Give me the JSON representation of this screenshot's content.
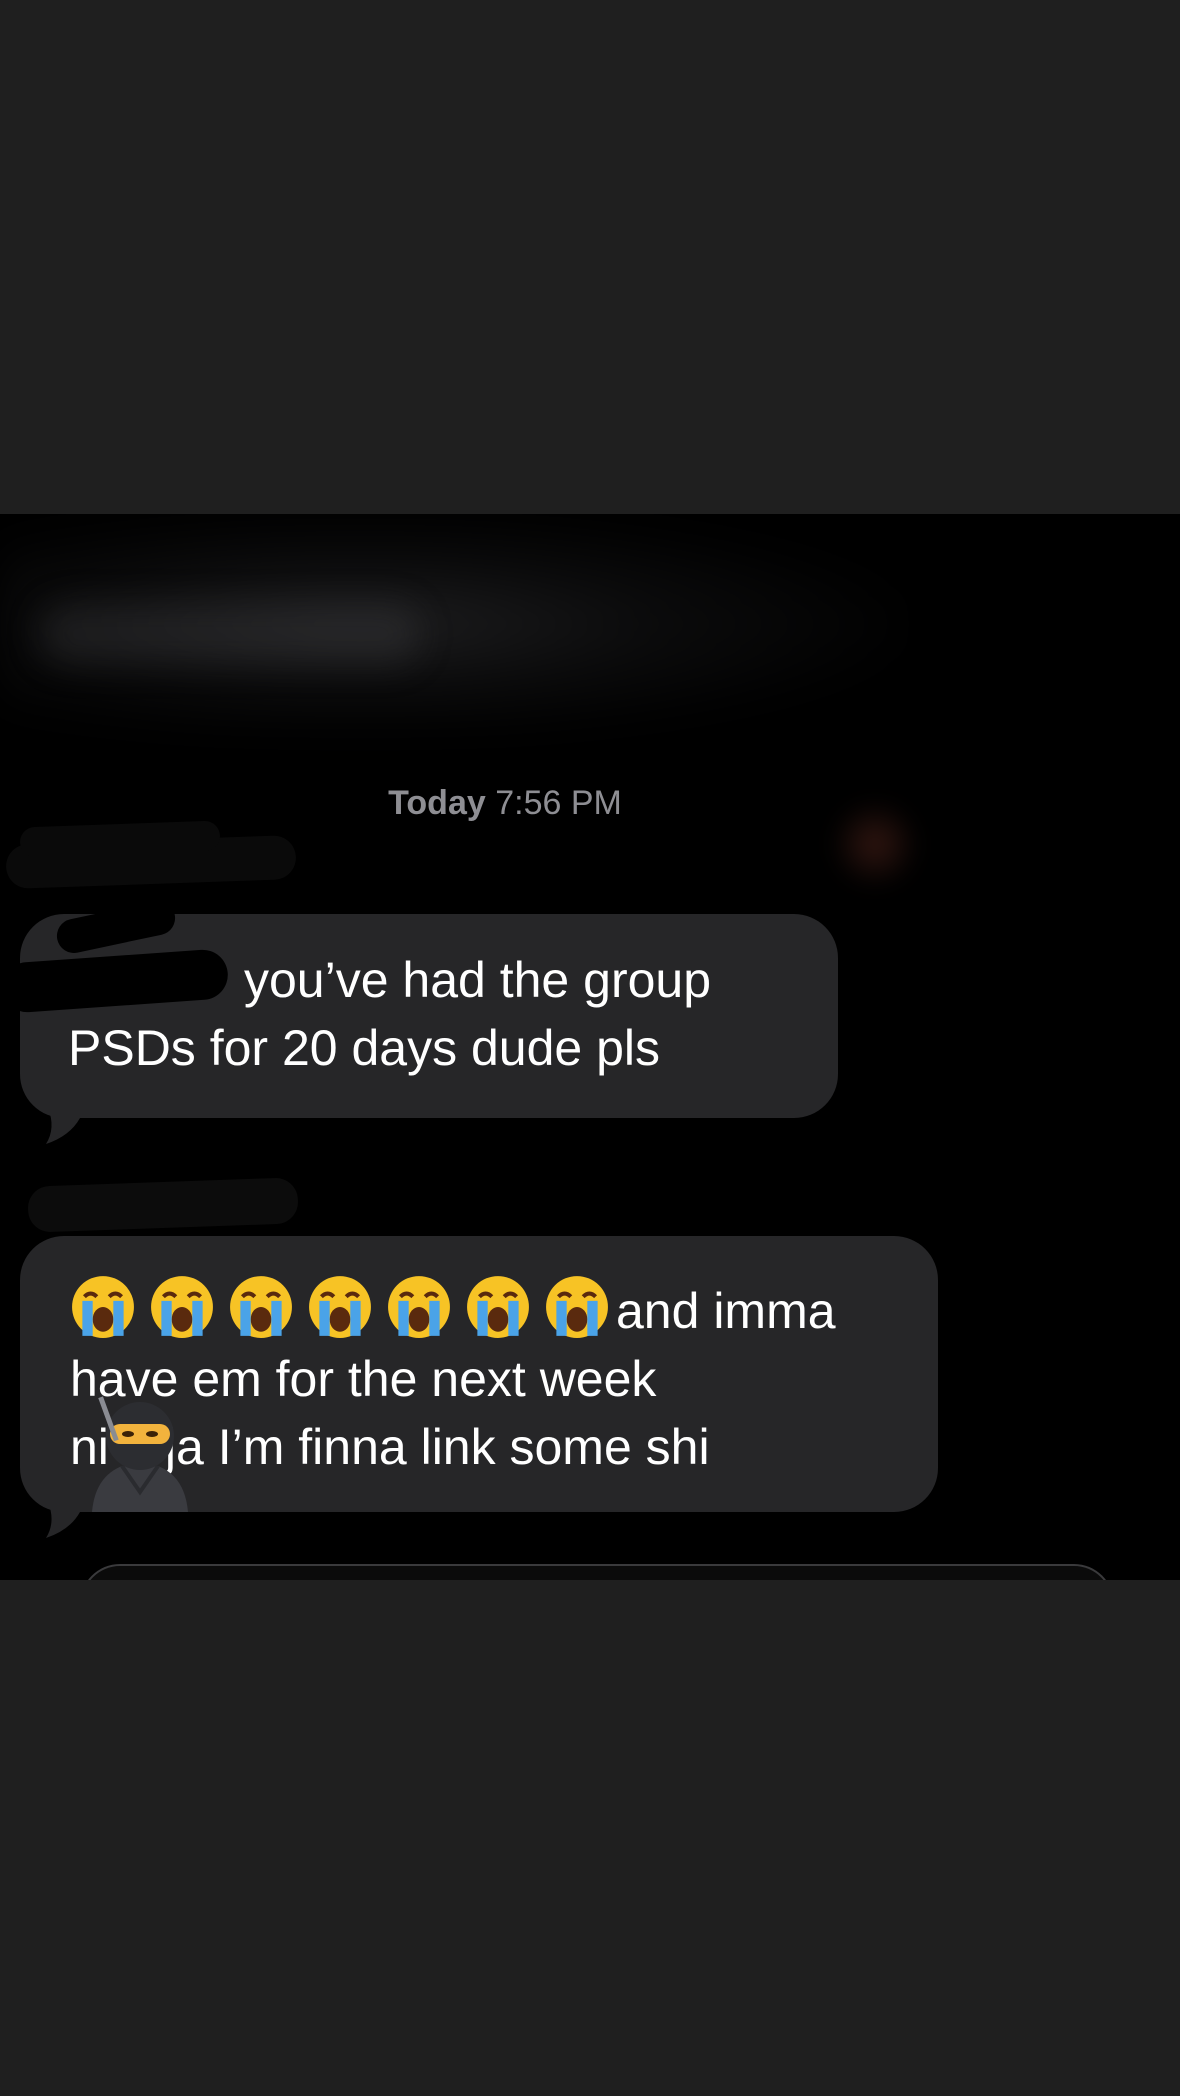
{
  "thread": {
    "timestamp_day": "Today",
    "timestamp_time": "7:56 PM"
  },
  "messages": [
    {
      "lines": [
        "you’ve had the group",
        "PSDs for 20 days dude pls"
      ]
    },
    {
      "emoji": "loudly-crying-face",
      "emoji_count": 7,
      "lines": [
        "and imma",
        "have em for the next week",
        "ni",
        "ja I’m finna link some shi"
      ],
      "overlay_emoji": "ninja"
    }
  ],
  "colors": {
    "background": "#1f1f1f",
    "chat_background": "#000000",
    "bubble": "#262628",
    "text": "#ffffff",
    "timestamp": "#8e8e93"
  },
  "icons": [
    "loudly-crying-face-icon",
    "ninja-icon"
  ]
}
